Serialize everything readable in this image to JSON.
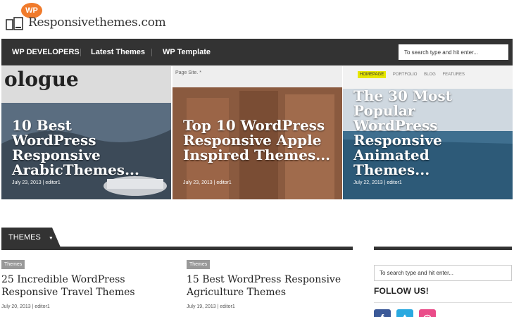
{
  "header": {
    "badge": "WP",
    "site_name": "Responsivethemes.com"
  },
  "nav": {
    "items": [
      "WP DEVELOPERS",
      "Latest Themes",
      "WP Template"
    ],
    "search_placeholder": "To search type and hit enter..."
  },
  "slider": [
    {
      "title": "10 Best WordPress Responsive ArabicThemes...",
      "date": "July 23, 2013",
      "author": "editor1",
      "bg_text": "ologue"
    },
    {
      "title": "Top 10 WordPress Responsive Apple Inspired Themes...",
      "date": "July 23, 2013",
      "author": "editor1",
      "bg_text": "Page Site. *"
    },
    {
      "title": "The 30 Most Popular WordPress Responsive Animated Themes...",
      "date": "July 22, 2013",
      "author": "editor1",
      "bg_menu": [
        "HOMEPAGE",
        "PORTFOLIO",
        "BLOG",
        "FEATURES"
      ]
    }
  ],
  "section": {
    "title": "THEMES",
    "caret": "▼"
  },
  "posts": [
    {
      "tag": "Themes",
      "title": "25 Incredible WordPress Responsive Travel Themes",
      "date": "July 20, 2013",
      "author": "editor1"
    },
    {
      "tag": "Themes",
      "title": "15 Best WordPress Responsive Agriculture Themes",
      "date": "July 19, 2013",
      "author": "editor1"
    }
  ],
  "sidebar": {
    "search_placeholder": "To search type and hit enter...",
    "follow_title": "FOLLOW US!",
    "social": [
      {
        "name": "facebook-icon",
        "glyph": "f",
        "color": "#3b5998"
      },
      {
        "name": "twitter-icon",
        "glyph": "t",
        "color": "#2aa9e0"
      },
      {
        "name": "dribbble-icon",
        "glyph": "◎",
        "color": "#ea4c89"
      }
    ]
  },
  "colors": {
    "accent": "#f07b2c",
    "nav_bg": "#333333",
    "menu_highlight": "#e6e600"
  }
}
